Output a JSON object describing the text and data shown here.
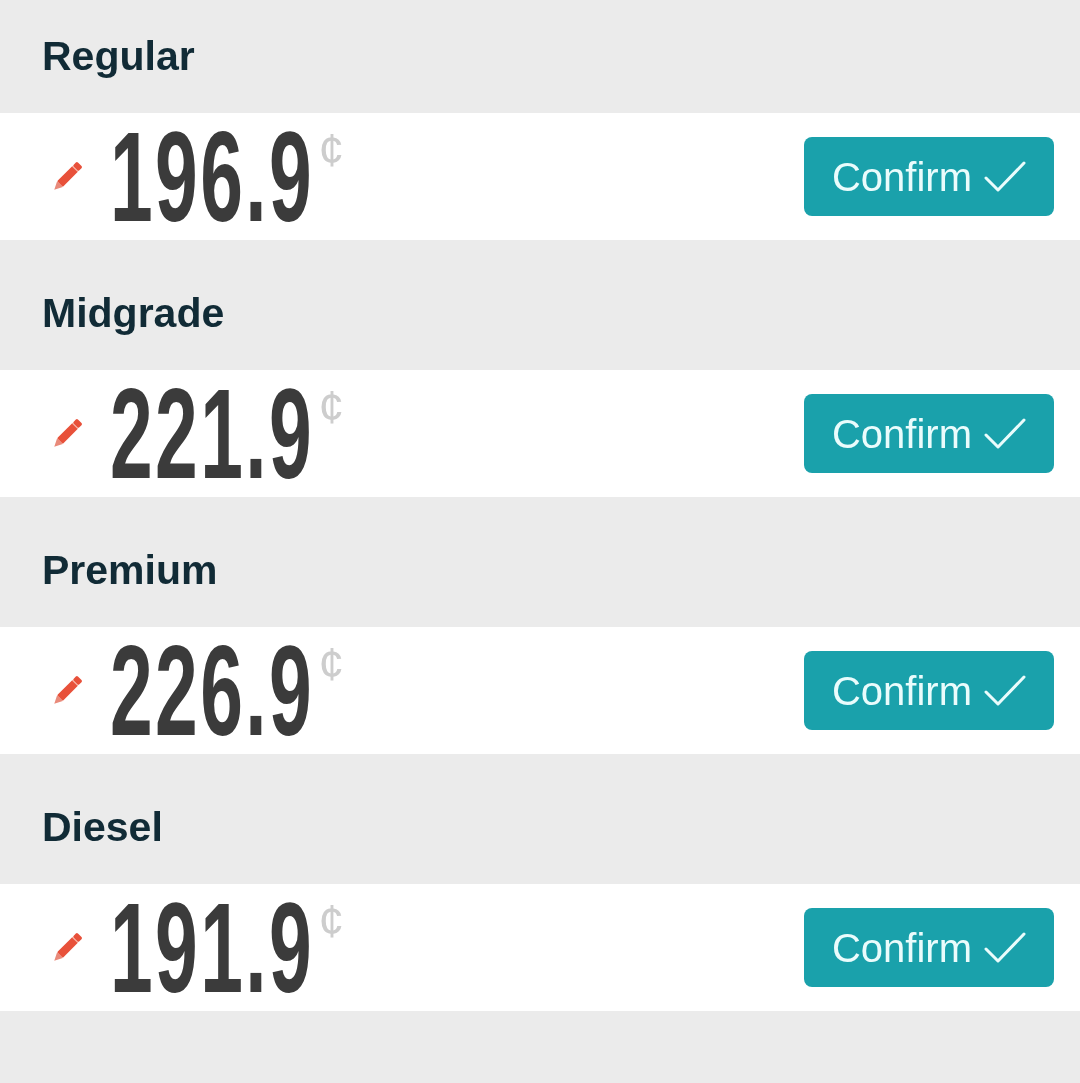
{
  "grades": [
    {
      "name": "Regular",
      "price": "196.9",
      "unit": "¢",
      "button": "Confirm"
    },
    {
      "name": "Midgrade",
      "price": "221.9",
      "unit": "¢",
      "button": "Confirm"
    },
    {
      "name": "Premium",
      "price": "226.9",
      "unit": "¢",
      "button": "Confirm"
    },
    {
      "name": "Diesel",
      "price": "191.9",
      "unit": "¢",
      "button": "Confirm"
    }
  ]
}
